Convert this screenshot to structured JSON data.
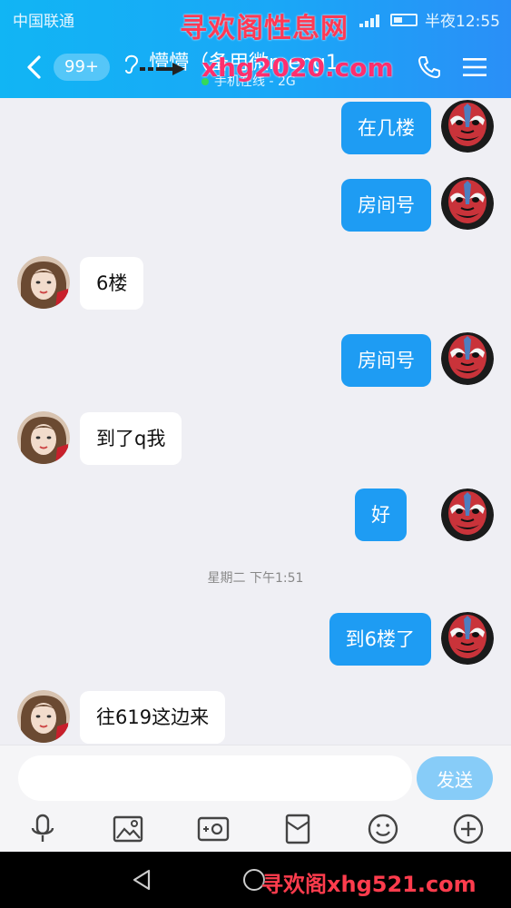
{
  "status_bar": {
    "carrier": "中国联通",
    "time": "半夜12:55"
  },
  "watermarks": {
    "top": "寻欢阁性息网",
    "middle": "xhg2020.com",
    "bottom": "寻欢阁xhg521.com"
  },
  "header": {
    "unread_count": "99+",
    "contact_name": "懵懵（备用微meng1",
    "contact_status": "手机在线 - 2G",
    "back_icon": "chevron-left-icon",
    "call_icon": "phone-icon",
    "menu_icon": "hamburger-menu-icon"
  },
  "messages": [
    {
      "sender": "me",
      "text": "在几楼"
    },
    {
      "sender": "me",
      "text": "房间号"
    },
    {
      "sender": "them",
      "text": "6楼"
    },
    {
      "sender": "me",
      "text": "房间号"
    },
    {
      "sender": "them",
      "text": "到了q我"
    },
    {
      "sender": "me",
      "text": "好"
    },
    {
      "sender": "system",
      "text": "星期二 下午1:51"
    },
    {
      "sender": "me",
      "text": "到6楼了"
    },
    {
      "sender": "them",
      "text": "往619这边来"
    }
  ],
  "input": {
    "value": "",
    "send_label": "发送"
  },
  "toolbar": [
    "microphone-icon",
    "image-icon",
    "camera-icon",
    "red-packet-icon",
    "emoji-icon",
    "plus-icon"
  ],
  "colors": {
    "header_start": "#11b5f4",
    "header_end": "#2a8ff7",
    "my_bubble": "#1e9cf3",
    "their_bubble": "#ffffff",
    "send_button": "#87ccf8"
  }
}
